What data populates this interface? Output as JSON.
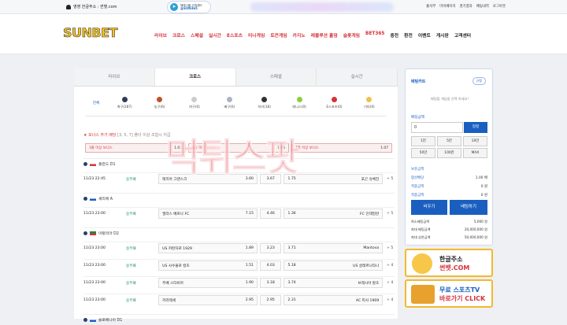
{
  "topbar": {
    "domain_text": "영영 한글주소 : 썬뱃.com",
    "telegram": {
      "line1": "텔레그램 고객센터",
      "line2": "@SUN365"
    },
    "links": [
      "출석부",
      "마이페이지",
      "경기결과",
      "배팅내역",
      "로그아웃"
    ]
  },
  "logo": "SUNBET",
  "nav": [
    {
      "label": "라이브",
      "color": "red"
    },
    {
      "label": "크로스",
      "color": "red"
    },
    {
      "label": "스페셜",
      "color": "red"
    },
    {
      "label": "실시간",
      "color": "red"
    },
    {
      "label": "E스포츠",
      "color": "red"
    },
    {
      "label": "미니게임",
      "color": "red"
    },
    {
      "label": "토큰게임",
      "color": "red"
    },
    {
      "label": "카지노",
      "color": "red"
    },
    {
      "label": "레볼루션 홀덤",
      "color": "red"
    },
    {
      "label": "슬롯게임",
      "color": "red"
    },
    {
      "label": "BET365",
      "color": "red"
    },
    {
      "label": "충전",
      "color": "black"
    },
    {
      "label": "환전",
      "color": "black"
    },
    {
      "label": "이벤트",
      "color": "black"
    },
    {
      "label": "게시판",
      "color": "black"
    },
    {
      "label": "고객센터",
      "color": "black"
    }
  ],
  "tabs": [
    "라이브",
    "크로스",
    "스페셜",
    "실시간"
  ],
  "active_tab": "크로스",
  "sports_all": "전체",
  "sports": [
    {
      "label": "축구(287)",
      "color": "#2f3c5c"
    },
    {
      "label": "농구(6)",
      "color": "#c0502a"
    },
    {
      "label": "야구(0)",
      "color": "#cccccc"
    },
    {
      "label": "배구(0)",
      "color": "#aab4c6"
    },
    {
      "label": "하키(18)",
      "color": "#333333"
    },
    {
      "label": "테니스(0)",
      "color": "#8ccf3a"
    },
    {
      "label": "E스포츠(0)",
      "color": "#d8313a"
    },
    {
      "label": "기타(0)",
      "color": "#f2c14a"
    }
  ],
  "bonus": {
    "title": "★ 보너스 추가 배당",
    "note": "[3, 5, 7] 폴더 이상 조합시 지급",
    "cells": [
      {
        "label": "3폴 이상 보너스",
        "value": "1.03"
      },
      {
        "label": "5폴 이상 보너스",
        "value": "1.05"
      },
      {
        "label": "7폴 이상 보너스",
        "value": "1.07"
      }
    ]
  },
  "leagues": [
    {
      "name": "폴란드 D1",
      "matches": [
        {
          "time": "11/23 22:45",
          "market": "승무패",
          "home": "레치아 그덴스크",
          "home_odds": "3.60",
          "draw": "3.67",
          "away_odds": "1.75",
          "away": "포곤 슈체친",
          "more": "+ 5"
        }
      ]
    },
    {
      "name": "세리에 A",
      "matches": [
        {
          "time": "11/23 23:00",
          "market": "승무패",
          "home": "엘라스 베로나 FC",
          "home_odds": "7.15",
          "draw": "4.46",
          "away_odds": "1.36",
          "away": "FC 인테밀란",
          "more": "+ 5"
        }
      ]
    },
    {
      "name": "이탈리아 D2",
      "matches": [
        {
          "time": "11/23 23:00",
          "market": "승무패",
          "home": "US 카탄차로 1929",
          "home_odds": "1.89",
          "draw": "3.23",
          "away_odds": "3.71",
          "away": "Mantova",
          "more": "+ 5"
        },
        {
          "time": "11/23 23:00",
          "market": "승무패",
          "home": "US 사수올로 칼초",
          "home_odds": "1.51",
          "draw": "4.03",
          "away_odds": "5.18",
          "away": "US 살레르니타나",
          "more": "+ 4"
        },
        {
          "time": "11/23 23:00",
          "market": "승무패",
          "home": "주베 스타비아",
          "home_odds": "1.90",
          "draw": "3.18",
          "away_odds": "3.74",
          "away": "브레시아 칼초",
          "more": "+ 4"
        },
        {
          "time": "11/23 23:00",
          "market": "승무패",
          "home": "카라레세",
          "home_odds": "2.95",
          "draw": "2.95",
          "away_odds": "2.31",
          "away": "AC 피사 1909",
          "more": "+ 4"
        }
      ]
    },
    {
      "name": "슬로베니아 D1",
      "matches": []
    }
  ],
  "watermark": "먹튀스팟",
  "slip": {
    "title": "배팅카트",
    "rules_btn": "규정",
    "empty": "배팅할 게임을 선택 하세요!",
    "amount_label": "배팅금액",
    "amount_value": "0",
    "max_btn": "정정",
    "chips": [
      "1만",
      "5만",
      "10만",
      "50만",
      "100만",
      "MAX"
    ],
    "lines": [
      {
        "label": "보유금액",
        "value": ""
      },
      {
        "label": "합산배당",
        "value": "1.00 배"
      },
      {
        "label": "적중금액",
        "value": "0 원"
      },
      {
        "label": "적중금액",
        "value": "0 원"
      }
    ],
    "clear_btn": "비우기",
    "bet_btn": "배팅하기",
    "limits": [
      {
        "label": "최소배팅금액",
        "value": "5,000 원"
      },
      {
        "label": "최대 배팅금액",
        "value": "20,000,000 원"
      },
      {
        "label": "최대 상한금액",
        "value": "50,000,000 원"
      }
    ]
  },
  "ads": [
    {
      "line1": "한글주소",
      "line2": "썬뱃.COM"
    },
    {
      "line1": "무료 스포츠TV",
      "line2": "바로가기 CLICK"
    }
  ]
}
